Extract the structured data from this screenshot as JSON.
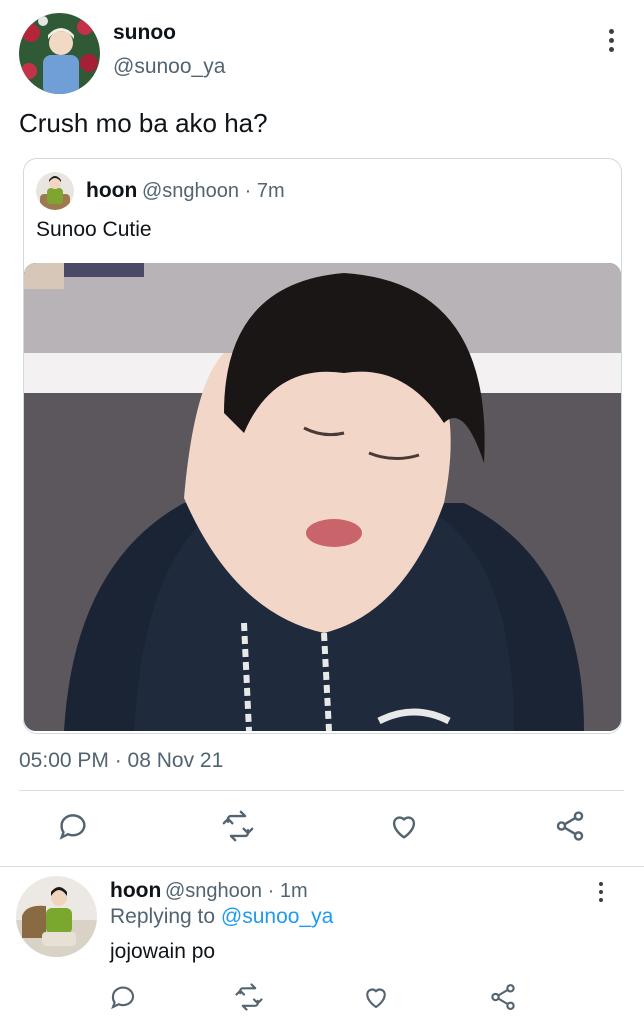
{
  "colors": {
    "text_primary": "#0f1419",
    "text_secondary": "#536471",
    "link": "#1d9bf0",
    "divider": "#d9dee2"
  },
  "tweet": {
    "author": {
      "name": "sunoo",
      "handle": "@sunoo_ya",
      "avatar_icon": "avatar-photo"
    },
    "text": "Crush mo ba ako ha?",
    "quote": {
      "author_name": "hoon",
      "meta": "@snghoon · 7m",
      "text": "Sunoo Cutie",
      "media_icon": "photo-thumbnail"
    },
    "timestamp": "05:00 PM · 08 Nov 21",
    "actions": [
      "comment-icon",
      "retweet-icon",
      "heart-icon",
      "share-icon"
    ]
  },
  "reply": {
    "author_name": "hoon",
    "meta": "@snghoon · 1m",
    "replying_prefix": "Replying to ",
    "replying_handle": "@sunoo_ya",
    "text": "jojowain po",
    "actions": [
      "comment-icon",
      "retweet-icon",
      "heart-icon",
      "share-icon"
    ]
  }
}
